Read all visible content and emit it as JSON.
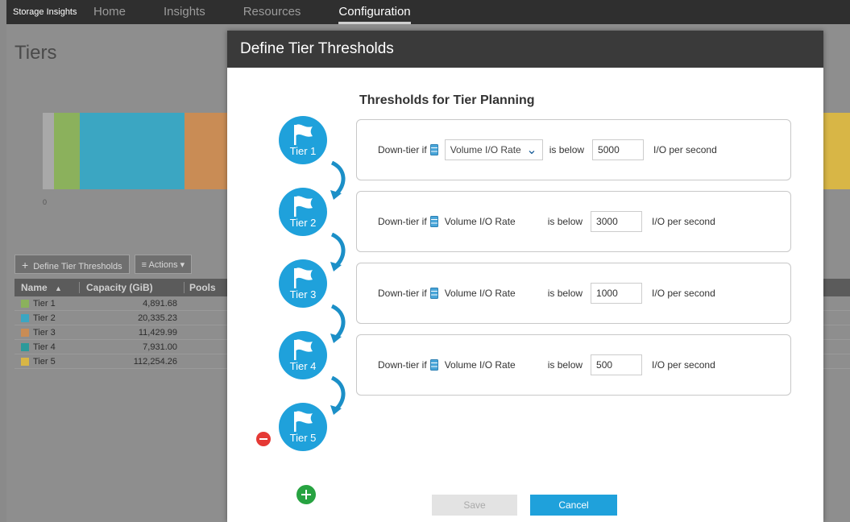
{
  "app": {
    "brand": "Storage Insights"
  },
  "nav": [
    {
      "label": "Home"
    },
    {
      "label": "Insights"
    },
    {
      "label": "Resources"
    },
    {
      "label": "Configuration"
    }
  ],
  "page": {
    "title": "Tiers",
    "axis_zero": "0",
    "toolbar": {
      "define_label": "Define Tier Thresholds",
      "actions_label": "Actions"
    },
    "table": {
      "headers": {
        "name": "Name",
        "capacity": "Capacity (GiB)",
        "pools": "Pools"
      },
      "rows": [
        {
          "name": "Tier 1",
          "capacity": "4,891.68",
          "color": "#8bb15c"
        },
        {
          "name": "Tier 2",
          "capacity": "20,335.23",
          "color": "#3ba6c2"
        },
        {
          "name": "Tier 3",
          "capacity": "11,429.99",
          "color": "#c98c55"
        },
        {
          "name": "Tier 4",
          "capacity": "7,931.00",
          "color": "#2c9a9a"
        },
        {
          "name": "Tier 5",
          "capacity": "112,254.26",
          "color": "#d8b646"
        }
      ]
    }
  },
  "modal": {
    "title": "Define Tier Thresholds",
    "section_title": "Thresholds for Tier Planning",
    "tiers": [
      {
        "label": "Tier 1"
      },
      {
        "label": "Tier 2"
      },
      {
        "label": "Tier 3"
      },
      {
        "label": "Tier 4"
      },
      {
        "label": "Tier 5"
      }
    ],
    "rules": [
      {
        "prefix": "Down-tier if",
        "metric": "Volume I/O Rate",
        "condition": "is below",
        "value": "5000",
        "unit": "I/O per second"
      },
      {
        "prefix": "Down-tier if",
        "metric": "Volume I/O Rate",
        "condition": "is below",
        "value": "3000",
        "unit": "I/O per second"
      },
      {
        "prefix": "Down-tier if",
        "metric": "Volume I/O Rate",
        "condition": "is below",
        "value": "1000",
        "unit": "I/O per second"
      },
      {
        "prefix": "Down-tier if",
        "metric": "Volume I/O Rate",
        "condition": "is below",
        "value": "500",
        "unit": "I/O per second"
      }
    ],
    "save_label": "Save",
    "cancel_label": "Cancel"
  },
  "colors": {
    "accent": "#1fa1db",
    "add": "#27a341",
    "remove": "#e53935"
  }
}
